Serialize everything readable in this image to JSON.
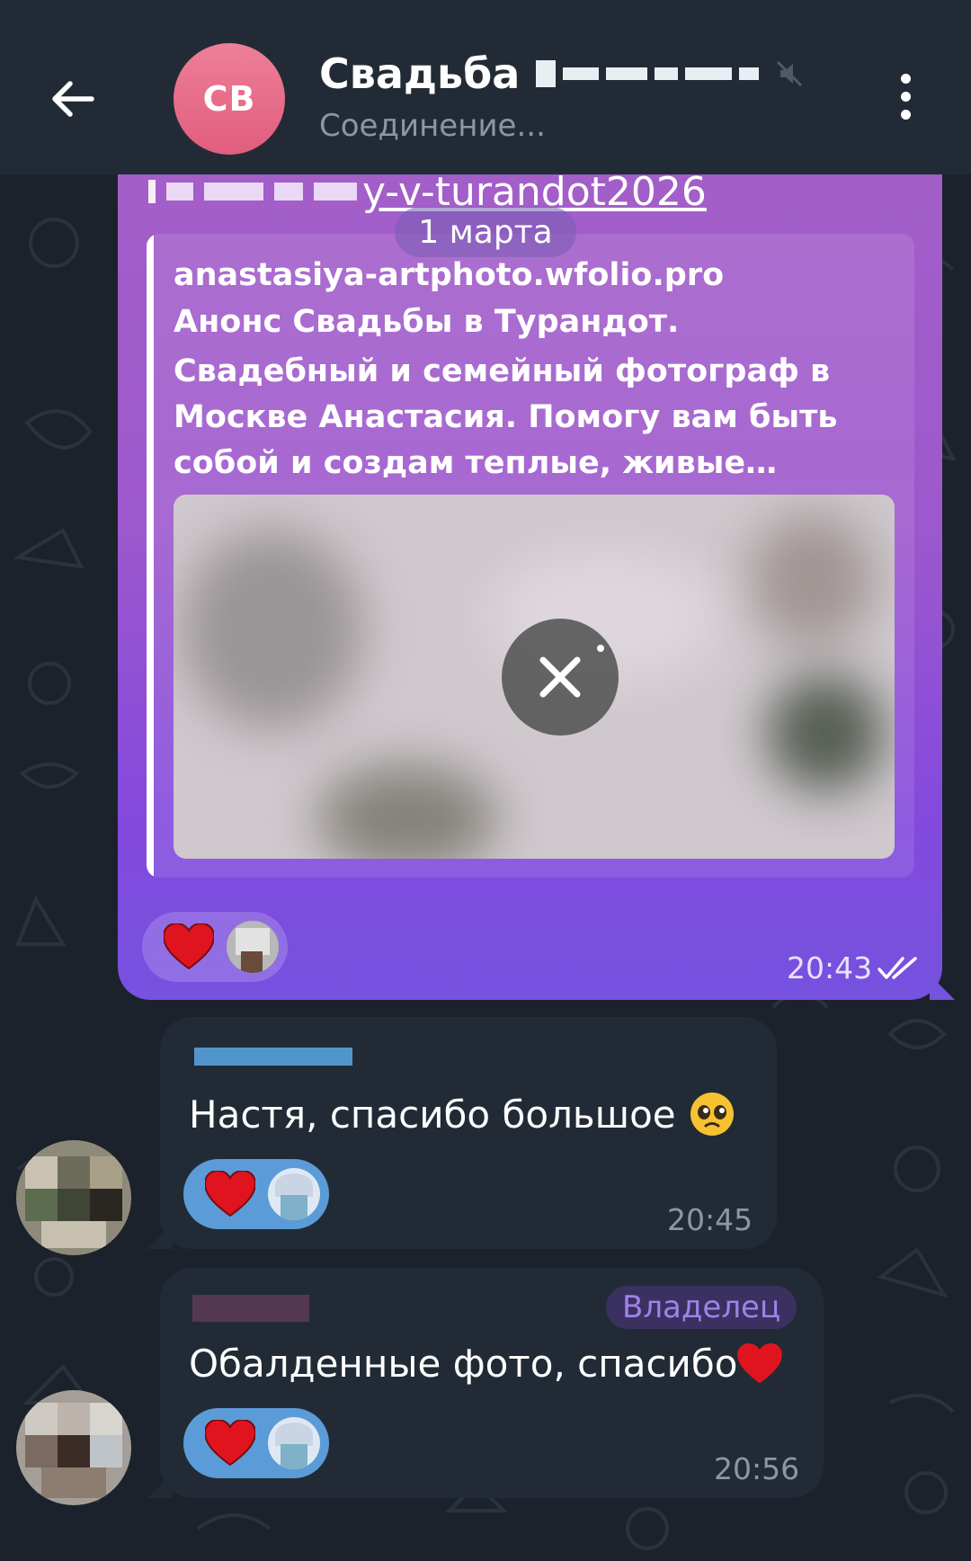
{
  "header": {
    "avatar_initials": "СВ",
    "title": "Свадьба",
    "status": "Соединение..."
  },
  "date_separator": "1 марта",
  "outgoing": {
    "link_text": "y-v-turandot2026",
    "preview": {
      "site": "anastasiya-artphoto.wfolio.pro",
      "title": "Анонс Свадьбы в Турандот.",
      "description": "Свадебный и семейный фотограф в Москве Анастасия. Помогу вам быть собой и создам теплые, живые…"
    },
    "time": "20:43",
    "reaction_icon": "heart"
  },
  "messages": [
    {
      "text": "Настя, спасибо большое",
      "emoji": "pleading-face",
      "time": "20:45",
      "reaction_icon": "heart"
    },
    {
      "text": "Обалденные фото, спасибо",
      "emoji": "red-heart",
      "badge": "Владелец",
      "time": "20:56",
      "reaction_icon": "heart"
    }
  ],
  "colors": {
    "header_bg": "#222b35",
    "chat_bg": "#1b222b",
    "outgoing_top": "#a45fc8",
    "outgoing_bottom": "#7552df",
    "incoming_bg": "#222b35",
    "avatar_pink": "#e8708b",
    "owner_badge_text": "#9d82e8",
    "reaction_bg": "#5b9cd8",
    "heart": "#e0141e"
  }
}
